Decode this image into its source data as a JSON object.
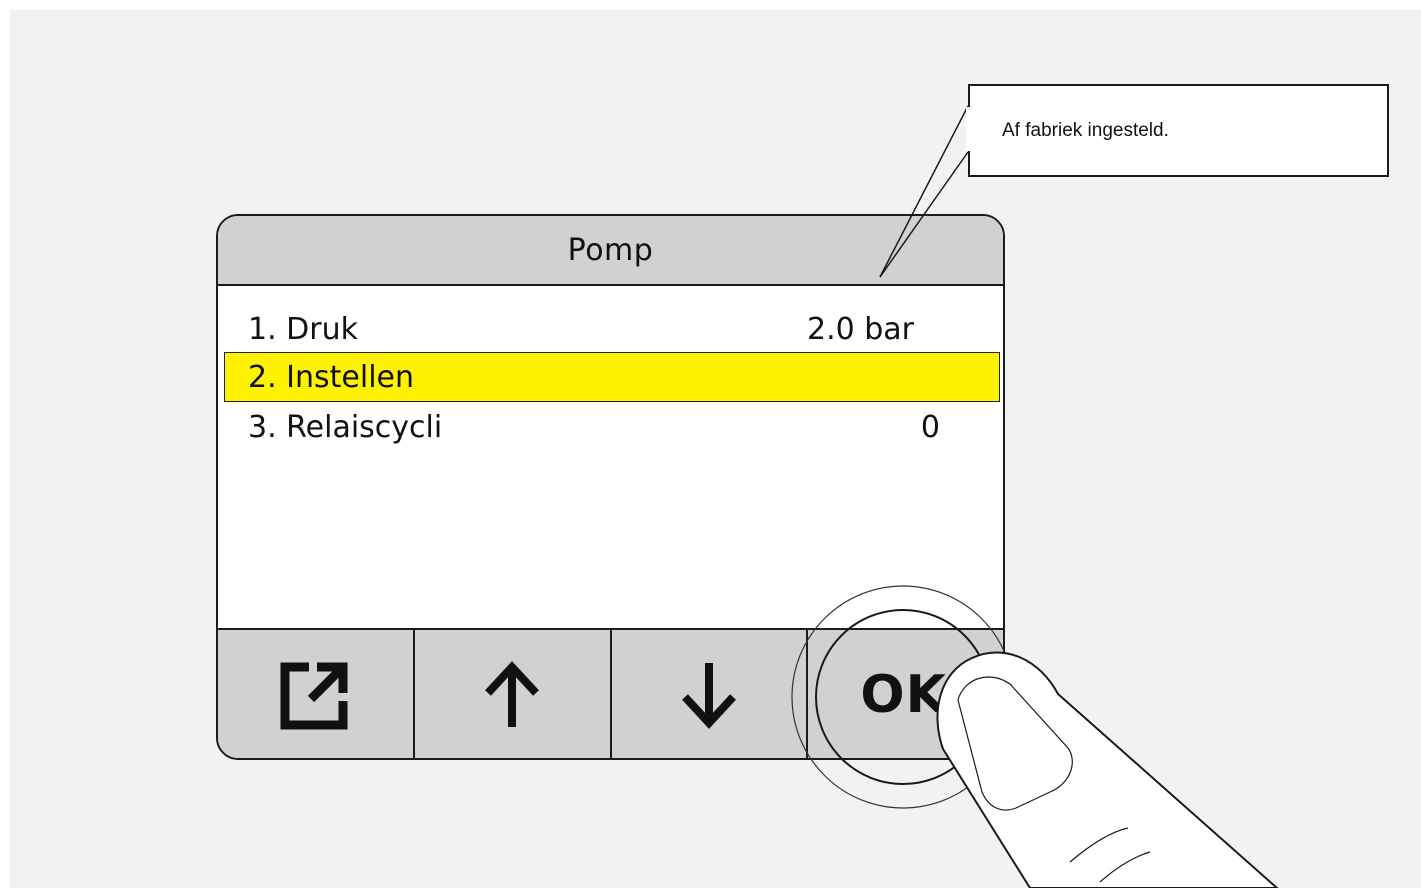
{
  "screen": {
    "title": "Pomp",
    "menu_items": [
      {
        "label": "1. Druk",
        "value": "2.0 bar",
        "selected": false
      },
      {
        "label": "2. Instellen",
        "value": "",
        "selected": true
      },
      {
        "label": "3. Relaiscycli",
        "value": "0",
        "selected": false
      }
    ],
    "highlight_color": "#fff200"
  },
  "softkeys": {
    "back_icon": "external-link-icon",
    "up_icon": "arrow-up-icon",
    "down_icon": "arrow-down-icon",
    "ok_label": "OK"
  },
  "callout": {
    "text": "Af fabriek ingesteld."
  },
  "gesture": {
    "icon": "finger-press-icon",
    "target": "OK"
  }
}
